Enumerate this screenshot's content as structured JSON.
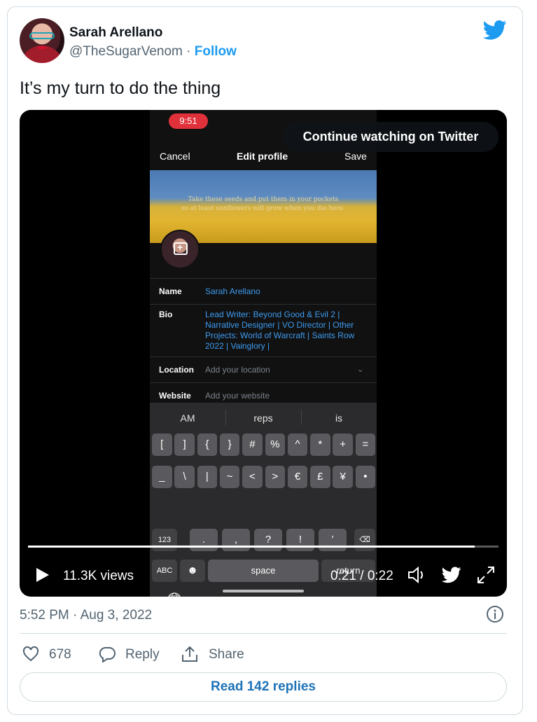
{
  "author": {
    "name": "Sarah Arellano",
    "handle": "@TheSugarVenom",
    "separator": "·",
    "follow_label": "Follow"
  },
  "tweet": {
    "text": "It’s my turn to do the thing",
    "timestamp": "5:52 PM · Aug 3, 2022"
  },
  "video": {
    "overlay": "Continue watching on Twitter",
    "views": "11.3K views",
    "time": "0:21 / 0:22",
    "progress": 0.95,
    "phone": {
      "clock": "9:51",
      "cancel": "Cancel",
      "title": "Edit profile",
      "save": "Save",
      "banner_quote_line1": "Take these seeds and put them in your pockets",
      "banner_quote_line2": "so at least sunflowers will grow when you die here.",
      "fields": {
        "name_label": "Name",
        "name_value": "Sarah Arellano",
        "bio_label": "Bio",
        "bio_line1": "Lead Writer: Beyond Good & Evil 2 |",
        "bio_line2": "Narrative Designer | VO Director | Other",
        "bio_line3": "Projects: World of Warcraft | Saints Row",
        "bio_line4": "2022 | Vainglory |",
        "location_label": "Location",
        "location_placeholder": "Add your location",
        "website_label": "Website",
        "website_placeholder": "Add your website"
      },
      "keyboard": {
        "suggestions": [
          "AM",
          "reps",
          "is"
        ],
        "row1": [
          "[",
          "]",
          "{",
          "}",
          "#",
          "%",
          "^",
          "*",
          "+",
          "="
        ],
        "row2": [
          "_",
          "\\",
          "|",
          "~",
          "<",
          ">",
          "€",
          "£",
          "¥",
          "•"
        ],
        "row3": [
          "123",
          ".",
          ",",
          "?",
          "!",
          "’"
        ],
        "abc": "ABC",
        "space": "space",
        "return": "return"
      }
    }
  },
  "actions": {
    "likes": "678",
    "reply": "Reply",
    "share": "Share"
  },
  "read_replies": "Read 142 replies",
  "colors": {
    "brand": "#1d9bf0",
    "text_secondary": "#536471"
  }
}
